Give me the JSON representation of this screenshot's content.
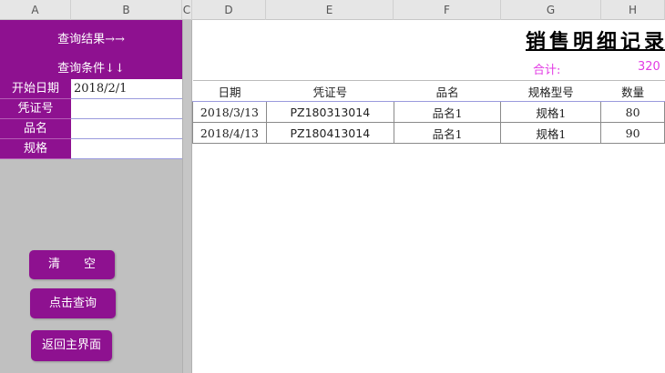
{
  "columns": [
    "A",
    "B",
    "C",
    "D",
    "E",
    "F",
    "G",
    "H"
  ],
  "panel": {
    "query_result_label": "查询结果→→",
    "query_condition_label": "查询条件↓↓",
    "fields": [
      {
        "label": "开始日期",
        "value": "2018/2/1"
      },
      {
        "label": "凭证号",
        "value": ""
      },
      {
        "label": "品名",
        "value": ""
      },
      {
        "label": "规格",
        "value": ""
      }
    ],
    "buttons": {
      "clear": "清　　空",
      "query": "点击查询",
      "back": "返回主界面"
    }
  },
  "report": {
    "title": "销售明细记录",
    "total_label": "合计:",
    "total_value": "320",
    "headers": [
      "日期",
      "凭证号",
      "品名",
      "规格型号",
      "数量"
    ],
    "rows": [
      [
        "2018/3/13",
        "PZ180313014",
        "品名1",
        "规格1",
        "80"
      ],
      [
        "2018/4/13",
        "PZ180413014",
        "品名1",
        "规格1",
        "90"
      ]
    ]
  },
  "colors": {
    "accent": "#8e1190",
    "total_text": "#e23be4",
    "panel_bg": "#c0c0c0"
  }
}
